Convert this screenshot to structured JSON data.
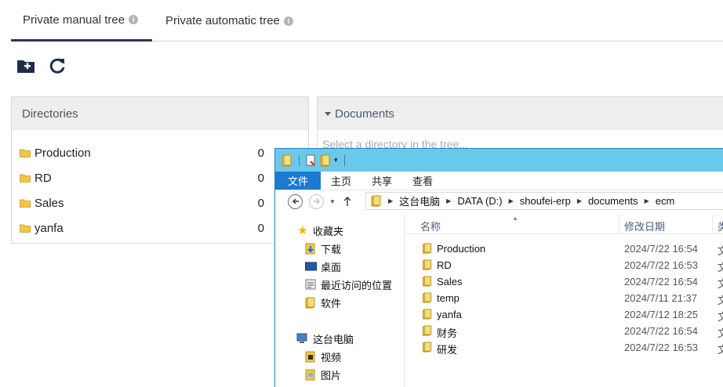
{
  "tabs": [
    {
      "label": "Private manual tree",
      "active": true
    },
    {
      "label": "Private automatic tree",
      "active": false
    }
  ],
  "toolbar": {
    "new_folder_icon": "folder-plus-icon",
    "refresh_icon": "refresh-icon"
  },
  "directories": {
    "title": "Directories",
    "items": [
      {
        "name": "Production",
        "count": "0"
      },
      {
        "name": "RD",
        "count": "0"
      },
      {
        "name": "Sales",
        "count": "0"
      },
      {
        "name": "yanfa",
        "count": "0"
      }
    ]
  },
  "documents": {
    "title": "Documents",
    "empty_text": "Select a directory in the tree..."
  },
  "explorer": {
    "ribbon_tabs": [
      "文件",
      "主页",
      "共享",
      "查看"
    ],
    "address": [
      "这台电脑",
      "DATA (D:)",
      "shoufei-erp",
      "documents",
      "ecm"
    ],
    "nav": {
      "favorites": "收藏夹",
      "downloads": "下载",
      "desktop": "桌面",
      "recent": "最近访问的位置",
      "software": "软件",
      "this_pc": "这台电脑",
      "videos": "视频",
      "pictures": "图片"
    },
    "columns": {
      "name": "名称",
      "date": "修改日期",
      "type": "类"
    },
    "files": [
      {
        "name": "Production",
        "date": "2024/7/22 16:54",
        "type": "文"
      },
      {
        "name": "RD",
        "date": "2024/7/22 16:53",
        "type": "文"
      },
      {
        "name": "Sales",
        "date": "2024/7/22 16:54",
        "type": "文"
      },
      {
        "name": "temp",
        "date": "2024/7/11 21:37",
        "type": "文"
      },
      {
        "name": "yanfa",
        "date": "2024/7/12 18:25",
        "type": "文"
      },
      {
        "name": "财务",
        "date": "2024/7/22 16:54",
        "type": "文"
      },
      {
        "name": "研发",
        "date": "2024/7/22 16:53",
        "type": "文"
      }
    ]
  }
}
